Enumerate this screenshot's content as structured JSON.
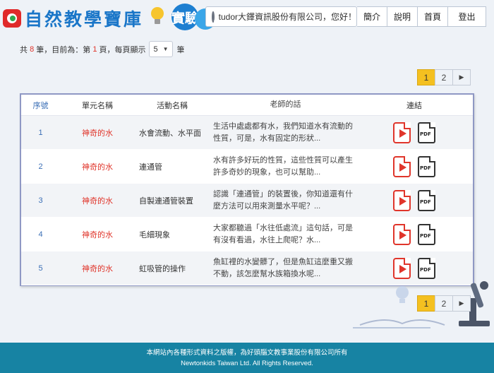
{
  "header": {
    "logo_text": "自然教學寶庫",
    "exp_text": "實驗",
    "user_greeting": "tudor大鐸資訊股份有限公司，您好！",
    "nav": [
      {
        "label": "簡介"
      },
      {
        "label": "說明"
      },
      {
        "label": "首頁"
      },
      {
        "label": "登出"
      }
    ]
  },
  "records": {
    "prefix": "共 ",
    "total": "8",
    "mid": " 筆，目前為：第 ",
    "page": "1",
    "suffix": " 頁，每頁顯示",
    "per_page": "5",
    "unit": "筆"
  },
  "pagination": {
    "pages": [
      "1",
      "2"
    ],
    "current": "1",
    "next": "▶"
  },
  "table": {
    "headers": {
      "no": "序號",
      "unit": "單元名稱",
      "activity": "活動名稱",
      "talk": "老師的話",
      "link": "連結"
    },
    "rows": [
      {
        "no": "1",
        "unit": "神奇的水",
        "activity": "水會流動、水平面",
        "talk": "生活中處處都有水，我們知道水有流動的性質，可是，水有固定的形狀..."
      },
      {
        "no": "2",
        "unit": "神奇的水",
        "activity": "連通管",
        "talk": "水有許多好玩的性質，這些性質可以產生許多奇妙的現象，也可以幫助..."
      },
      {
        "no": "3",
        "unit": "神奇的水",
        "activity": "自製連通管裝置",
        "talk": "認識「連通管」的裝置後，你知道還有什麼方法可以用來測量水平呢？..."
      },
      {
        "no": "4",
        "unit": "神奇的水",
        "activity": "毛細現象",
        "talk": "大家都聽過「水往低處流」這句話，可是有沒有看過，水往上爬呢？水..."
      },
      {
        "no": "5",
        "unit": "神奇的水",
        "activity": "虹吸管的操作",
        "talk": "魚缸裡的水變髒了，但是魚缸這麼重又搬不動，該怎麼幫水族箱換水呢..."
      }
    ],
    "pdf_label": "PDF"
  },
  "footer": {
    "line1": "本網站內各種形式資料之版權，為好頭腦文教事業股份有限公司所有",
    "line2": "Newtonkids Taiwan Ltd. All Rights Reserved."
  },
  "colors": {
    "accent_red": "#e0352b",
    "link_blue": "#3b6fb6",
    "footer_bg": "#1783a3",
    "page_active": "#f4c020"
  }
}
